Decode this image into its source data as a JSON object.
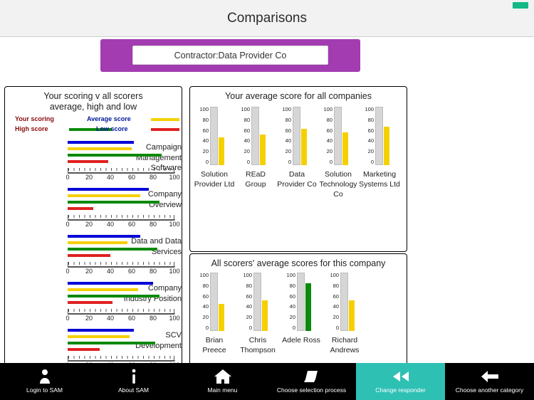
{
  "header": {
    "title": "Comparisons",
    "battery_icon": "battery-icon"
  },
  "banner": {
    "value": "Contractor:Data Provider Co"
  },
  "left_panel": {
    "title_line1": "Your scoring v all scorers",
    "title_line2": "average, high and low",
    "legend": [
      {
        "label": "Your scoring",
        "color": "#0000d8"
      },
      {
        "label": "Average score",
        "color": "#f5d000"
      },
      {
        "label": "High score",
        "color": "#0b8a0b"
      },
      {
        "label": "Low score",
        "color": "#e02020"
      }
    ],
    "axis_ticks": [
      "0",
      "20",
      "40",
      "60",
      "80",
      "100"
    ],
    "categories": [
      {
        "label": "Campaign Management Software",
        "values": {
          "your": 62,
          "average": 60,
          "high": 88,
          "low": 38
        }
      },
      {
        "label": "Company Overview",
        "values": {
          "your": 76,
          "average": 68,
          "high": 86,
          "low": 24
        }
      },
      {
        "label": "Data and Data Services",
        "values": {
          "your": 68,
          "average": 56,
          "high": 84,
          "low": 40
        }
      },
      {
        "label": "Company Industry Position",
        "values": {
          "your": 80,
          "average": 66,
          "high": 86,
          "low": 42
        }
      },
      {
        "label": "SCV Development",
        "values": {
          "your": 62,
          "average": 58,
          "high": 82,
          "low": 30
        }
      }
    ]
  },
  "right_top_panel": {
    "title": "Your average score for all companies",
    "axis_ticks": [
      "100",
      "80",
      "60",
      "40",
      "20",
      "0"
    ],
    "bar_color": "#f5d000",
    "companies": [
      {
        "label": "Solution Provider Ltd",
        "value": 48
      },
      {
        "label": "REaD Group",
        "value": 52
      },
      {
        "label": "Data Provider Co",
        "value": 62
      },
      {
        "label": "Solution Technology Co",
        "value": 56
      },
      {
        "label": "Marketing Systems Ltd",
        "value": 66
      }
    ]
  },
  "right_bottom_panel": {
    "title": "All scorers' average scores for this company",
    "axis_ticks": [
      "100",
      "80",
      "60",
      "40",
      "20",
      "0"
    ],
    "scorers": [
      {
        "label": "Brian Preece",
        "value": 46,
        "color": "#f5d000"
      },
      {
        "label": "Chris Thompson",
        "value": 52,
        "color": "#f5d000"
      },
      {
        "label": "Adele Ross",
        "value": 82,
        "color": "#0b8a0b"
      },
      {
        "label": "Richard Andrews",
        "value": 52,
        "color": "#f5d000"
      }
    ]
  },
  "toolbar": {
    "items": [
      {
        "label": "Login to SAM",
        "icon": "person-icon",
        "active": false
      },
      {
        "label": "About SAM",
        "icon": "info-icon",
        "active": false
      },
      {
        "label": "Main menu",
        "icon": "home-icon",
        "active": false
      },
      {
        "label": "Choose selection process",
        "icon": "layers-icon",
        "active": false
      },
      {
        "label": "Change responder",
        "icon": "rewind-icon",
        "active": true
      },
      {
        "label": "Choose another category",
        "icon": "back-arrow-icon",
        "active": false
      }
    ]
  }
}
